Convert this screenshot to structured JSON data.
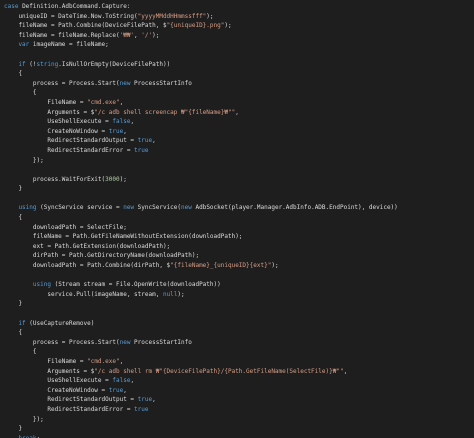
{
  "colors": {
    "background": "#1e1e1e",
    "text": "#dcdcdc",
    "keyword": "#569cd6",
    "string": "#d69d85",
    "number": "#b5cea8",
    "type": "#4ec9b0"
  },
  "code_lines": [
    [
      [
        "kw",
        "case"
      ],
      [
        "id",
        " Definition.AdbCommand.Capture:"
      ]
    ],
    [
      [
        "id",
        "    uniqueID = DateTime.Now.ToString("
      ],
      [
        "str",
        "\"yyyyMMddHHmmssfff\""
      ],
      [
        "id",
        ");"
      ]
    ],
    [
      [
        "id",
        "    fileName = Path.Combine(DeviceFilePath, $"
      ],
      [
        "str",
        "\"{uniqueID}.png\""
      ],
      [
        "id",
        ");"
      ]
    ],
    [
      [
        "id",
        "    fileName = fileName.Replace("
      ],
      [
        "str",
        "'₩₩'"
      ],
      [
        "id",
        ", "
      ],
      [
        "str",
        "'/'"
      ],
      [
        "id",
        ");"
      ]
    ],
    [
      [
        "kw",
        "    var"
      ],
      [
        "id",
        " imageName = fileName;"
      ]
    ],
    [
      [
        "id",
        ""
      ]
    ],
    [
      [
        "kw",
        "    if"
      ],
      [
        "id",
        " (!"
      ],
      [
        "kw",
        "string"
      ],
      [
        "id",
        ".IsNullOrEmpty(DeviceFilePath))"
      ]
    ],
    [
      [
        "id",
        "    {"
      ]
    ],
    [
      [
        "id",
        "        process = Process.Start("
      ],
      [
        "kw",
        "new"
      ],
      [
        "id",
        " ProcessStartInfo"
      ]
    ],
    [
      [
        "id",
        "        {"
      ]
    ],
    [
      [
        "id",
        "            FileName = "
      ],
      [
        "str",
        "\"cmd.exe\""
      ],
      [
        "id",
        ","
      ]
    ],
    [
      [
        "id",
        "            Arguments = $"
      ],
      [
        "str",
        "\"/c adb shell screencap ₩\"{fileName}₩\"\""
      ],
      [
        "id",
        ","
      ]
    ],
    [
      [
        "id",
        "            UseShellExecute = "
      ],
      [
        "kw",
        "false"
      ],
      [
        "id",
        ","
      ]
    ],
    [
      [
        "id",
        "            CreateNoWindow = "
      ],
      [
        "kw",
        "true"
      ],
      [
        "id",
        ","
      ]
    ],
    [
      [
        "id",
        "            RedirectStandardOutput = "
      ],
      [
        "kw",
        "true"
      ],
      [
        "id",
        ","
      ]
    ],
    [
      [
        "id",
        "            RedirectStandardError = "
      ],
      [
        "kw",
        "true"
      ]
    ],
    [
      [
        "id",
        "        });"
      ]
    ],
    [
      [
        "id",
        ""
      ]
    ],
    [
      [
        "id",
        "        process.WaitForExit("
      ],
      [
        "num",
        "3000"
      ],
      [
        "id",
        ");"
      ]
    ],
    [
      [
        "id",
        "    }"
      ]
    ],
    [
      [
        "id",
        ""
      ]
    ],
    [
      [
        "kw",
        "    using"
      ],
      [
        "id",
        " (SyncService service = "
      ],
      [
        "kw",
        "new"
      ],
      [
        "id",
        " SyncService("
      ],
      [
        "kw",
        "new"
      ],
      [
        "id",
        " AdbSocket(player.Manager.AdbInfo.ADB.EndPoint), device))"
      ]
    ],
    [
      [
        "id",
        "    {"
      ]
    ],
    [
      [
        "id",
        "        downloadPath = SelectFile;"
      ]
    ],
    [
      [
        "id",
        "        fileName = Path.GetFileNameWithoutExtension(downloadPath);"
      ]
    ],
    [
      [
        "id",
        "        ext = Path.GetExtension(downloadPath);"
      ]
    ],
    [
      [
        "id",
        "        dirPath = Path.GetDirectoryName(downloadPath);"
      ]
    ],
    [
      [
        "id",
        "        downloadPath = Path.Combine(dirPath, $"
      ],
      [
        "str",
        "\"{fileName}_{uniqueID}{ext}\""
      ],
      [
        "id",
        ");"
      ]
    ],
    [
      [
        "id",
        ""
      ]
    ],
    [
      [
        "kw",
        "        using"
      ],
      [
        "id",
        " (Stream stream = File.OpenWrite(downloadPath))"
      ]
    ],
    [
      [
        "id",
        "            service.Pull(imageName, stream, "
      ],
      [
        "kw",
        "null"
      ],
      [
        "id",
        ");"
      ]
    ],
    [
      [
        "id",
        "    }"
      ]
    ],
    [
      [
        "id",
        ""
      ]
    ],
    [
      [
        "kw",
        "    if"
      ],
      [
        "id",
        " (UseCaptureRemove)"
      ]
    ],
    [
      [
        "id",
        "    {"
      ]
    ],
    [
      [
        "id",
        "        process = Process.Start("
      ],
      [
        "kw",
        "new"
      ],
      [
        "id",
        " ProcessStartInfo"
      ]
    ],
    [
      [
        "id",
        "        {"
      ]
    ],
    [
      [
        "id",
        "            FileName = "
      ],
      [
        "str",
        "\"cmd.exe\""
      ],
      [
        "id",
        ","
      ]
    ],
    [
      [
        "id",
        "            Arguments = $"
      ],
      [
        "str",
        "\"/c adb shell rm ₩\"{DeviceFilePath}/{Path.GetFileName(SelectFile)}₩\"\""
      ],
      [
        "id",
        ","
      ]
    ],
    [
      [
        "id",
        "            UseShellExecute = "
      ],
      [
        "kw",
        "false"
      ],
      [
        "id",
        ","
      ]
    ],
    [
      [
        "id",
        "            CreateNoWindow = "
      ],
      [
        "kw",
        "true"
      ],
      [
        "id",
        ","
      ]
    ],
    [
      [
        "id",
        "            RedirectStandardOutput = "
      ],
      [
        "kw",
        "true"
      ],
      [
        "id",
        ","
      ]
    ],
    [
      [
        "id",
        "            RedirectStandardError = "
      ],
      [
        "kw",
        "true"
      ]
    ],
    [
      [
        "id",
        "        });"
      ]
    ],
    [
      [
        "id",
        "    }"
      ]
    ],
    [
      [
        "kw",
        "    break"
      ],
      [
        "id",
        ";"
      ]
    ]
  ]
}
